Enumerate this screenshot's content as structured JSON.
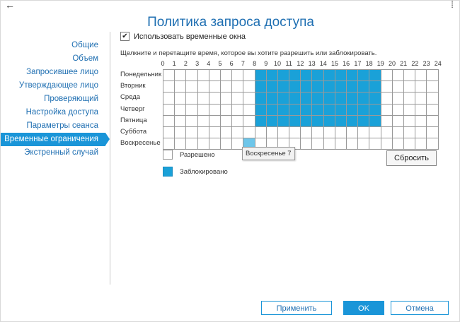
{
  "window": {
    "title": "Политика запроса доступа",
    "back_icon": "←",
    "close_icon": "⁞"
  },
  "sidebar": {
    "items": [
      {
        "label": "Общие"
      },
      {
        "label": "Объем"
      },
      {
        "label": "Запросившее лицо"
      },
      {
        "label": "Утверждающее лицо"
      },
      {
        "label": "Проверяющий"
      },
      {
        "label": "Настройка доступа"
      },
      {
        "label": "Параметры сеанса"
      },
      {
        "label": "Временные ограничения",
        "active": true
      },
      {
        "label": "Экстренный случай"
      }
    ]
  },
  "main": {
    "use_time_windows": {
      "checked": true,
      "check_glyph": "✔",
      "label": "Использовать временные окна"
    },
    "instruction": "Щелкните и перетащите время, которое вы хотите разрешить или заблокировать.",
    "hours": [
      "0",
      "1",
      "2",
      "3",
      "4",
      "5",
      "6",
      "7",
      "8",
      "9",
      "10",
      "11",
      "12",
      "13",
      "14",
      "15",
      "16",
      "17",
      "18",
      "19",
      "20",
      "21",
      "22",
      "23",
      "24"
    ],
    "days": [
      "Понедельник",
      "Вторник",
      "Среда",
      "Четверг",
      "Пятница",
      "Суббота",
      "Воскресенье"
    ],
    "schedule": {
      "blocked_rows": [
        0,
        1,
        2,
        3,
        4
      ],
      "blocked_hours_start": 8,
      "blocked_hours_end": 19,
      "hover_cell": {
        "day": 6,
        "hour": 7
      }
    },
    "tooltip": "Воскресенье 7",
    "legend": {
      "allowed": "Разрешено",
      "blocked": "Заблокировано"
    },
    "reset_label": "Сбросить",
    "colors": {
      "blocked": "#1aa1d8",
      "hover": "#6ec6ea",
      "accent": "#1a95d8"
    }
  },
  "footer": {
    "apply_label": "Применить",
    "ok_label": "OK",
    "cancel_label": "Отмена"
  }
}
